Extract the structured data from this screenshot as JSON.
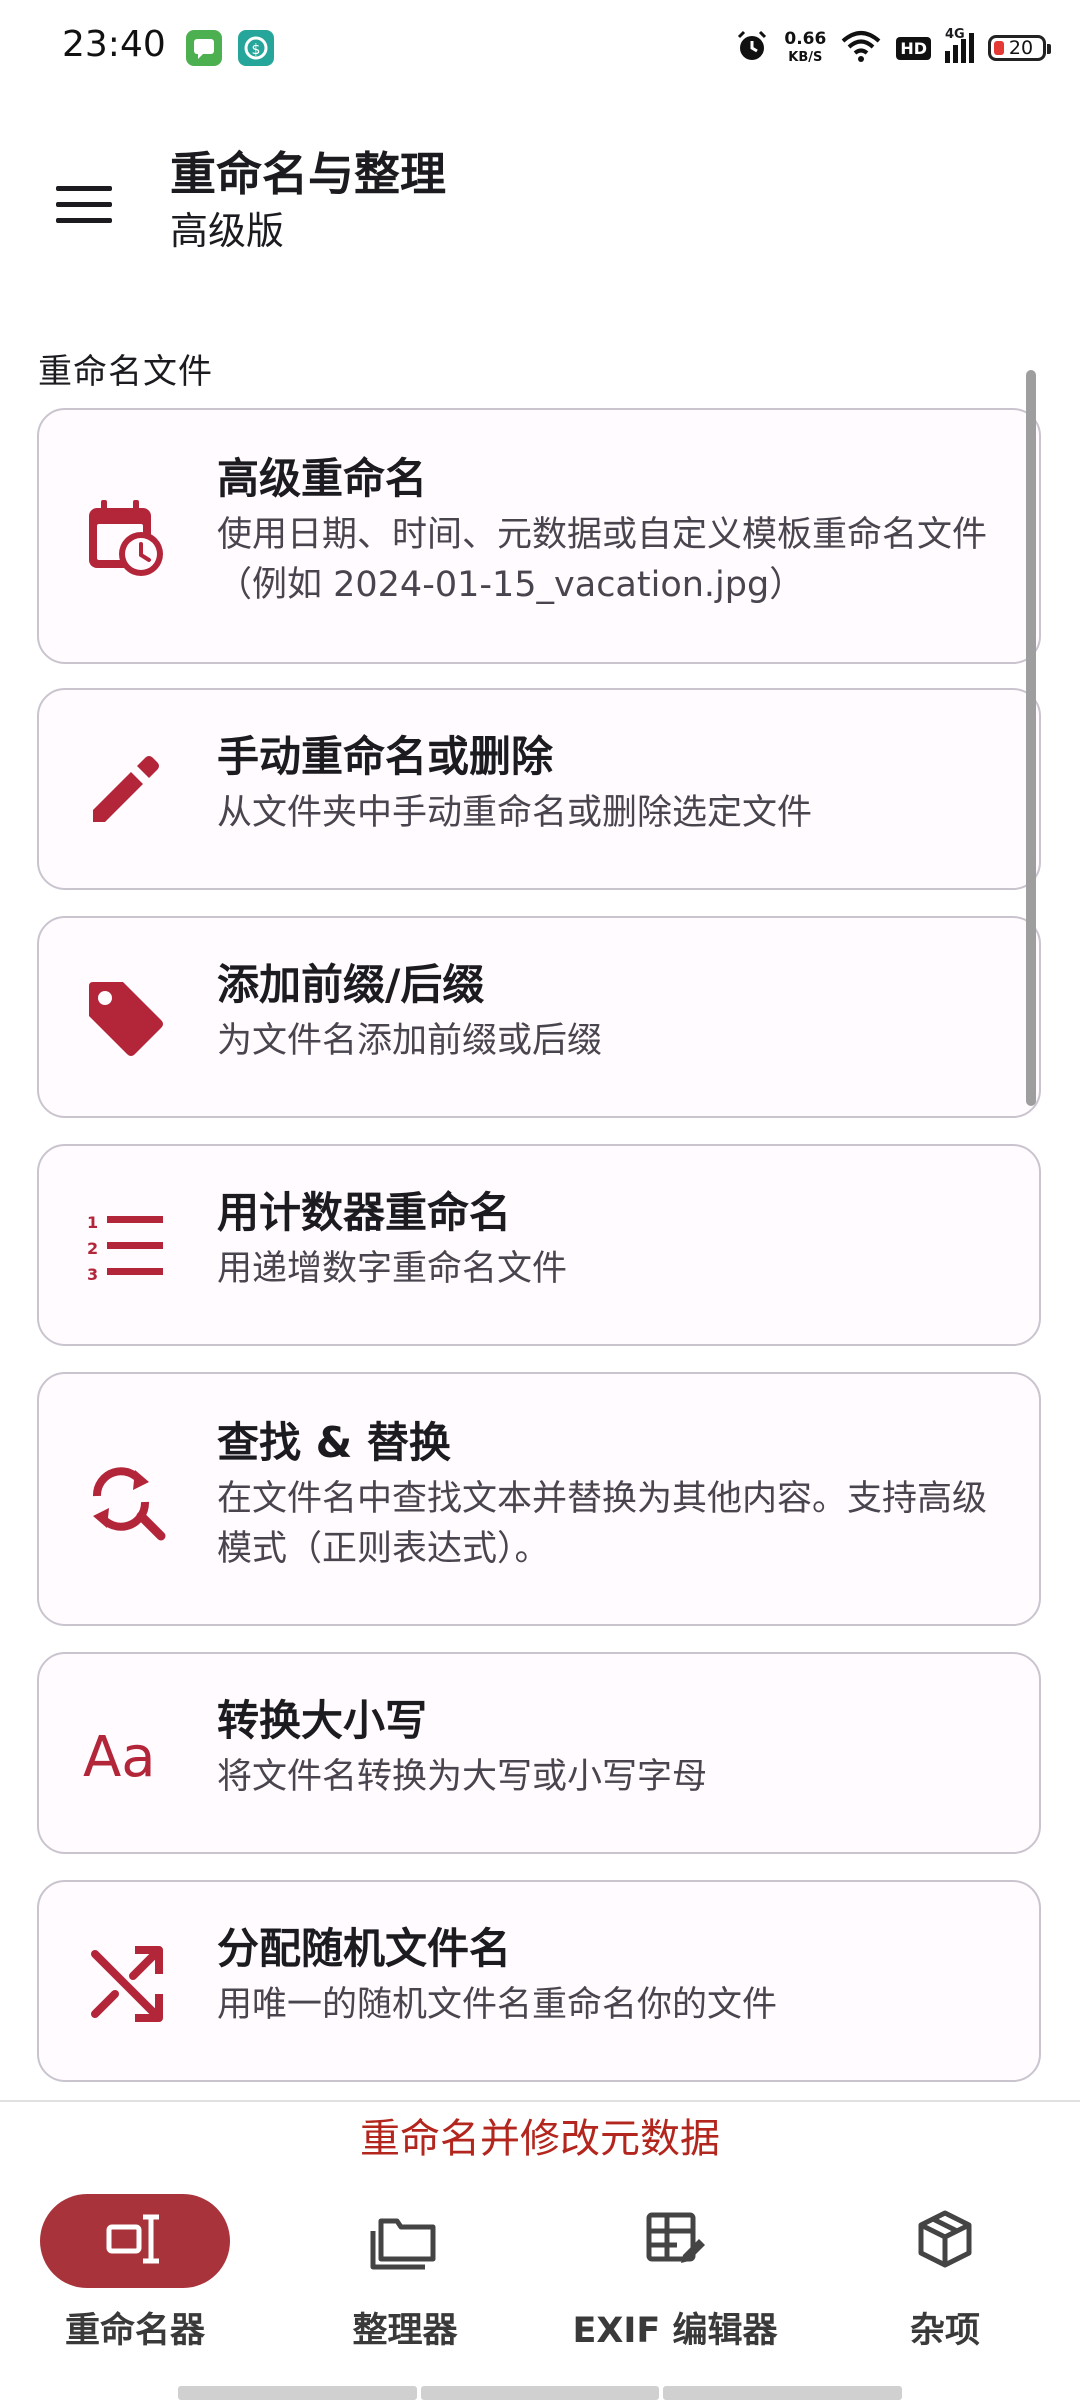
{
  "status_bar": {
    "time": "23:40",
    "speed_value": "0.66",
    "speed_unit": "KB/S",
    "hd_label": "HD",
    "network_label": "4G",
    "battery_level": "20",
    "battery_color": "#e53935"
  },
  "header": {
    "title": "重命名与整理",
    "subtitle": "高级版"
  },
  "section": {
    "title": "重命名文件"
  },
  "cards": [
    {
      "icon": "calendar-clock-icon",
      "title": "高级重命名",
      "desc": "使用日期、时间、元数据或自定义模板重命名文件（例如 2024-01-15_vacation.jpg）"
    },
    {
      "icon": "pencil-icon",
      "title": "手动重命名或删除",
      "desc": "从文件夹中手动重命名或删除选定文件"
    },
    {
      "icon": "tag-icon",
      "title": "添加前缀/后缀",
      "desc": "为文件名添加前缀或后缀"
    },
    {
      "icon": "numbered-list-icon",
      "title": "用计数器重命名",
      "desc": "用递增数字重命名文件"
    },
    {
      "icon": "find-replace-icon",
      "title": "查找 & 替换",
      "desc": "在文件名中查找文本并替换为其他内容。支持高级模式（正则表达式）。"
    },
    {
      "icon": "text-case-icon",
      "title": "转换大小写",
      "desc": "将文件名转换为大写或小写字母"
    },
    {
      "icon": "shuffle-icon",
      "title": "分配随机文件名",
      "desc": "用唯一的随机文件名重命名你的文件"
    }
  ],
  "bottom_caption": "重命名并修改元数据",
  "nav": [
    {
      "label": "重命名器",
      "icon": "rename-cursor-icon",
      "active": true
    },
    {
      "label": "整理器",
      "icon": "folders-icon",
      "active": false
    },
    {
      "label": "EXIF 编辑器",
      "icon": "table-edit-icon",
      "active": false
    },
    {
      "label": "杂项",
      "icon": "package-icon",
      "active": false
    }
  ],
  "colors": {
    "accent": "#b3263a",
    "nav_active": "#a8333a",
    "card_border": "#cac4cf"
  }
}
